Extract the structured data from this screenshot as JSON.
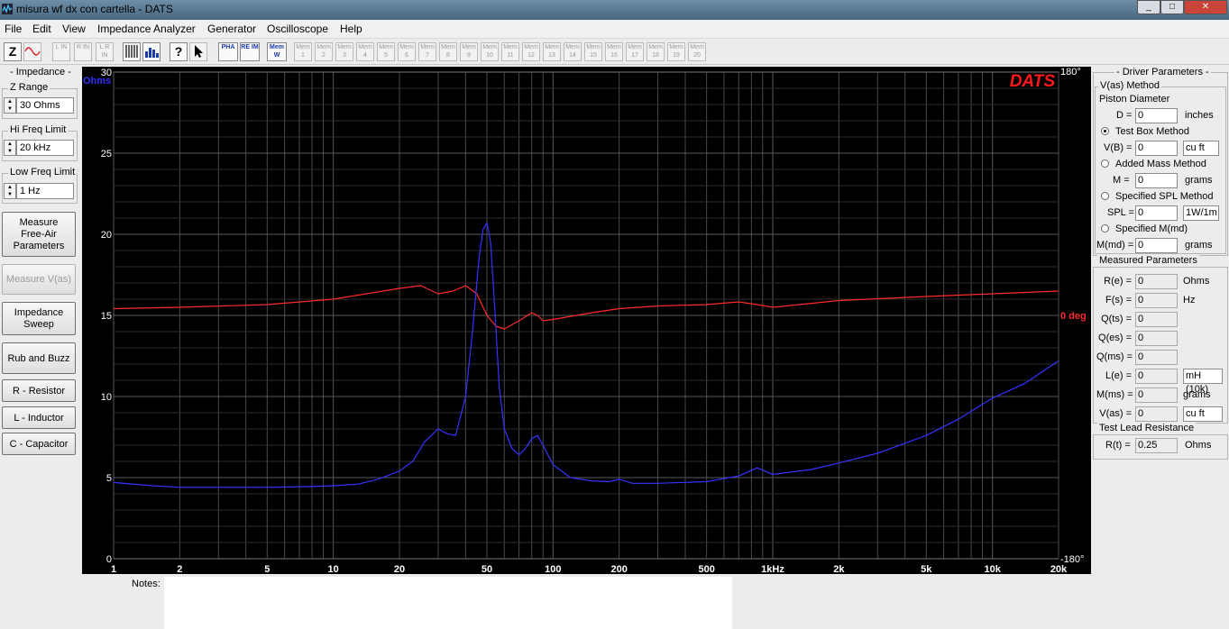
{
  "window": {
    "title": "misura wf dx con cartella - DATS"
  },
  "menu": [
    "File",
    "Edit",
    "View",
    "Impedance Analyzer",
    "Generator",
    "Oscilloscope",
    "Help"
  ],
  "toolbar": {
    "z_label": "Z",
    "lin_buttons": [
      "L IN",
      "R IN",
      "L R IN"
    ],
    "help_label": "?",
    "pha_label": "PHA",
    "reim_label": "RE IM",
    "mem_label": "Mem",
    "mem_w": "W",
    "mem_slots": [
      "1",
      "2",
      "3",
      "4",
      "5",
      "6",
      "7",
      "8",
      "9",
      "10",
      "11",
      "12",
      "13",
      "14",
      "15",
      "16",
      "17",
      "18",
      "19",
      "20"
    ]
  },
  "left": {
    "impedance_title": "- Impedance -",
    "z_range": {
      "label": "Z Range",
      "value": "30 Ohms"
    },
    "hi_freq": {
      "label": "Hi Freq Limit",
      "value": "20 kHz"
    },
    "low_freq": {
      "label": "Low Freq Limit",
      "value": "1 Hz"
    },
    "buttons": {
      "measure_free_air": [
        "Measure",
        "Free-Air",
        "Parameters"
      ],
      "measure_vas": "Measure V(as)",
      "impedance_sweep": [
        "Impedance",
        "Sweep"
      ],
      "rub_buzz": "Rub and Buzz",
      "r_resistor": "R - Resistor",
      "l_inductor": "L - Inductor",
      "c_capacitor": "C - Capacitor"
    }
  },
  "right": {
    "driver_title": "- Driver Parameters -",
    "vas_method": "V(as) Method",
    "piston_diameter": "Piston Diameter",
    "d_label": "D =",
    "d_value": "0",
    "d_unit": "inches",
    "test_box": "Test Box Method",
    "vb_label": "V(B) =",
    "vb_value": "0",
    "vb_unit": "cu ft",
    "added_mass": "Added Mass Method",
    "m_label": "M =",
    "m_value": "0",
    "m_unit": "grams",
    "specified_spl": "Specified SPL Method",
    "spl_label": "SPL =",
    "spl_value": "0",
    "spl_unit": "1W/1m",
    "specified_mmd": "Specified M(md)",
    "mmd_label": "M(md) =",
    "mmd_value": "0",
    "mmd_unit": "grams",
    "measured_title": "Measured Parameters",
    "measured": [
      {
        "label": "R(e) =",
        "value": "0",
        "unit": "Ohms"
      },
      {
        "label": "F(s) =",
        "value": "0",
        "unit": "Hz"
      },
      {
        "label": "Q(ts) =",
        "value": "0",
        "unit": ""
      },
      {
        "label": "Q(es) =",
        "value": "0",
        "unit": ""
      },
      {
        "label": "Q(ms) =",
        "value": "0",
        "unit": ""
      },
      {
        "label": "L(e) =",
        "value": "0",
        "unit": "mH (10k)"
      },
      {
        "label": "M(ms) =",
        "value": "0",
        "unit": "grams"
      },
      {
        "label": "V(as) =",
        "value": "0",
        "unit": "cu ft"
      }
    ],
    "lead_title": "Test Lead Resistance",
    "rt_label": "R(t) =",
    "rt_value": "0.25",
    "rt_unit": "Ohms"
  },
  "notes_label": "Notes:",
  "colors": {
    "impedance": "#3333ff",
    "phase": "#ff2a2a",
    "grid": "#4a4a4a",
    "logo": "#ff1a1a"
  },
  "chart_data": {
    "type": "line",
    "brand": "DATS",
    "xscale": "log",
    "xlim": [
      1,
      20000
    ],
    "x_ticks": [
      1,
      2,
      5,
      10,
      20,
      50,
      100,
      200,
      500,
      1000,
      2000,
      5000,
      10000,
      20000
    ],
    "x_tick_labels": [
      "1",
      "2",
      "5",
      "10",
      "20",
      "50",
      "100",
      "200",
      "500",
      "1kHz",
      "2k",
      "5k",
      "10k",
      "20k"
    ],
    "y_left": {
      "label": "Ohms",
      "lim": [
        0,
        30
      ],
      "ticks": [
        0,
        5,
        10,
        15,
        20,
        25,
        30
      ],
      "tick_labels": [
        "0",
        "5",
        "10",
        "15",
        "20",
        "25",
        "30"
      ]
    },
    "y_right": {
      "lim": [
        -180,
        180
      ],
      "ticks": [
        180,
        0,
        -180
      ],
      "tick_labels": [
        "180°",
        "0 deg",
        "-180°"
      ]
    },
    "grid": true,
    "series": [
      {
        "axis": "left",
        "x": [
          1,
          1.5,
          2,
          3,
          5,
          8,
          10,
          13,
          16,
          20,
          23,
          26,
          30,
          33,
          36,
          40,
          43,
          46,
          48,
          50,
          52,
          54,
          57,
          60,
          65,
          70,
          75,
          80,
          85,
          90,
          100,
          120,
          150,
          180,
          200,
          230,
          300,
          500,
          700,
          850,
          1000,
          1500,
          2000,
          3000,
          5000,
          7000,
          10000,
          14000,
          20000
        ],
        "values": [
          4.7,
          4.5,
          4.4,
          4.4,
          4.4,
          4.45,
          4.5,
          4.6,
          4.9,
          5.4,
          6.0,
          7.2,
          8.0,
          7.7,
          7.6,
          10.0,
          14.0,
          18.5,
          20.3,
          20.7,
          19.5,
          16.0,
          10.5,
          8.0,
          6.8,
          6.4,
          6.8,
          7.4,
          7.6,
          7.0,
          5.8,
          5.0,
          4.8,
          4.75,
          4.9,
          4.65,
          4.65,
          4.75,
          5.1,
          5.6,
          5.2,
          5.5,
          5.9,
          6.5,
          7.6,
          8.6,
          9.9,
          10.8,
          12.2
        ]
      },
      {
        "axis": "right",
        "x": [
          1,
          2,
          5,
          10,
          20,
          25,
          30,
          35,
          40,
          45,
          50,
          55,
          60,
          70,
          80,
          85,
          90,
          100,
          150,
          200,
          300,
          500,
          700,
          850,
          1000,
          2000,
          5000,
          10000,
          20000
        ],
        "values": [
          5,
          6,
          8,
          12,
          20,
          22,
          16,
          18,
          22,
          16,
          0,
          -8,
          -10,
          -4,
          2,
          0,
          -4,
          -3,
          2,
          5,
          7,
          8,
          10,
          8,
          6,
          11,
          14,
          16,
          18
        ]
      }
    ]
  }
}
